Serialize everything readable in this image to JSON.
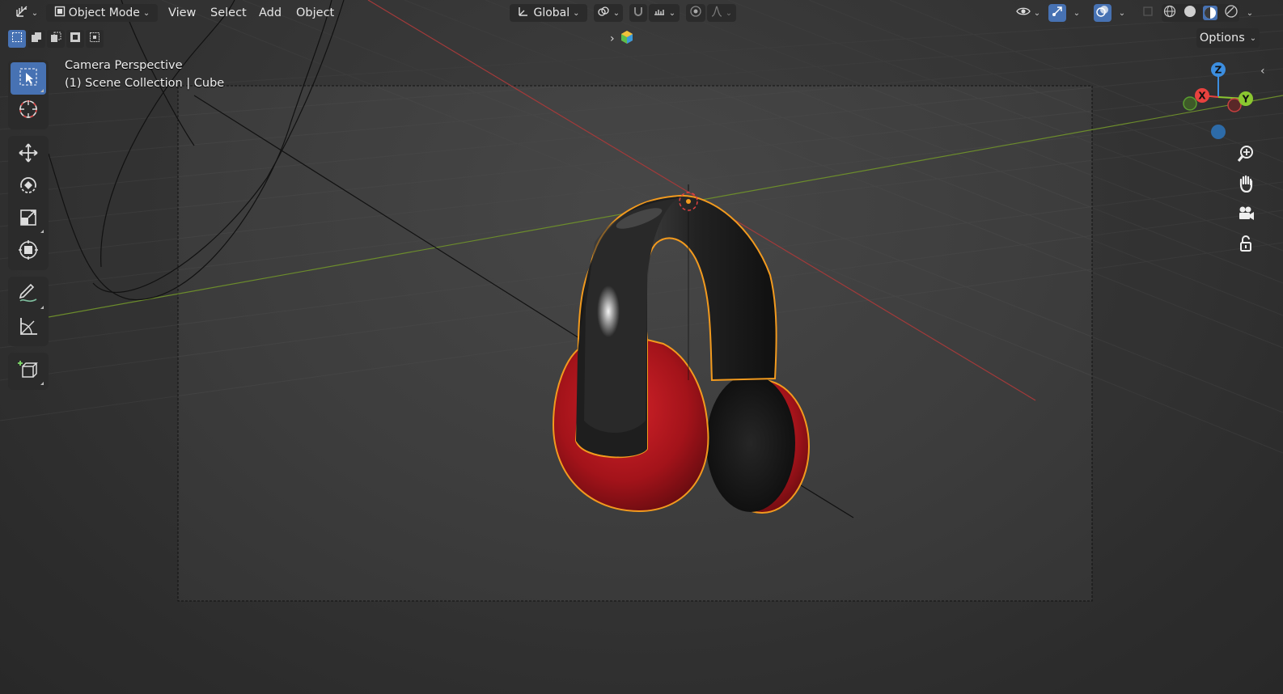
{
  "header": {
    "editor_type_icon": "axes-grid-icon",
    "mode": "Object Mode",
    "menus": [
      "View",
      "Select",
      "Add",
      "Object"
    ],
    "transform_orientation": "Global",
    "options_label": "Options"
  },
  "viewport": {
    "view_name": "Camera Perspective",
    "collection_line": "(1) Scene Collection | Cube"
  },
  "toolbar": {
    "tools": [
      "select-box-icon",
      "cursor-icon",
      "move-icon",
      "rotate-icon",
      "scale-icon",
      "transform-icon",
      "annotate-icon",
      "measure-icon",
      "add-cube-icon"
    ],
    "active_tool": "select-box-icon"
  },
  "gizmo": {
    "axes": [
      "X",
      "Y",
      "Z"
    ],
    "colors": {
      "x": "#e8423f",
      "y": "#8bc730",
      "z": "#3c8ee0",
      "neg_y": "#5a9e30",
      "neg_z": "#2d6ba8"
    }
  },
  "colors": {
    "accent": "#4772b3",
    "selection_outline": "#f29a1e",
    "earcup": "#b3141a",
    "headband": "#232323"
  }
}
